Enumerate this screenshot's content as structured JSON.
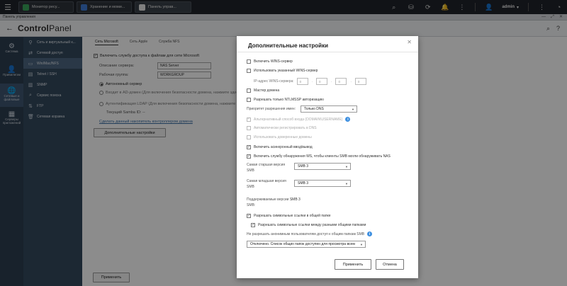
{
  "topbar": {
    "tabs": [
      {
        "label": "Монитор ресу...",
        "color": "#3aa55a"
      },
      {
        "label": "Хранение и моми...",
        "color": "#3f7bd6"
      },
      {
        "label": "Панель управ...",
        "color": "#e8e8e8"
      }
    ],
    "user": "admin"
  },
  "subbar": {
    "label": "Панель управления"
  },
  "header": {
    "title_prefix": "Control",
    "title_suffix": "Panel"
  },
  "rail": [
    {
      "label": "Система",
      "icon": "gear-icon",
      "glyph": "⚙"
    },
    {
      "label": "Привилегии",
      "icon": "user-icon",
      "glyph": "👤"
    },
    {
      "label": "Сетевые и файловые",
      "icon": "network-icon",
      "glyph": "🌐"
    },
    {
      "label": "Серверы приложений",
      "icon": "apps-icon",
      "glyph": "▦"
    }
  ],
  "subnav": [
    {
      "label": "Сеть и виртуальный к...",
      "glyph": "⚲"
    },
    {
      "label": "Сетевой доступ",
      "glyph": "⇄"
    },
    {
      "label": "Win/Mac/NFS",
      "glyph": "▭"
    },
    {
      "label": "Telnet / SSH",
      "glyph": "▤"
    },
    {
      "label": "SNMP",
      "glyph": "▥"
    },
    {
      "label": "Сервис поиска",
      "glyph": "⌕"
    },
    {
      "label": "FTP",
      "glyph": "⇅"
    },
    {
      "label": "Сетевая корзина",
      "glyph": "🗑"
    }
  ],
  "main": {
    "tabs": [
      "Сеть Microsoft",
      "Сеть Apple",
      "Служба NFS"
    ],
    "enable_label": "Включить службу доступа к файлам для сети Microsoft",
    "server_desc_label": "Описание сервера:",
    "server_desc_value": "NAS Server",
    "workgroup_label": "Рабочая группа:",
    "workgroup_value": "WORKGROUP",
    "standalone_label": "Автономный сервер",
    "ad_label": "Входит в AD-домен (Для включения безопасности домена, нажмите здесь.)",
    "ldap_label": "Аутентификация LDAP (Для включения безопасности домена, нажмите здесь.)",
    "samba_id_label": "Текущий Samba ID: --",
    "link_label": "Сделать данный накопитель контроллером домена",
    "advanced_button": "Дополнительные настройки",
    "apply_button": "Применить"
  },
  "modal": {
    "title": "Дополнительные настройки",
    "wins_server": "Включить WINS-сервер",
    "use_wins": "Использовать указанный WINS-сервер",
    "wins_ip_label": "IP-адрес WINS-сервера:",
    "ip_octets": [
      "0",
      "0",
      "0",
      "0"
    ],
    "domain_master": "Мастер домена",
    "ntlmssp": "Разрешать только NTLMSSP авторизацию",
    "name_resolution_label": "Приоритет разрешения имен:",
    "name_resolution_value": "Только DNS",
    "alt_login": "Альтернативный способ входа (DOMAIN\\USERNAME)",
    "auto_dns": "Автоматически регистрировать в DNS",
    "trusted_domains": "Использовать доверенные домены",
    "async_io": "Включить асинхронный ввод/вывод",
    "ws_discovery": "Включить службу обнаружения WS, чтобы клиенты SMB могли обнаруживать NAS",
    "highest_smb_label_1": "Самая старшая версия",
    "highest_smb_label_2": "SMB",
    "highest_smb_value": "SMB 3",
    "lowest_smb_label_1": "Самая младшая версия",
    "lowest_smb_label_2": "SMB",
    "lowest_smb_value": "SMB 3",
    "supported_label_1": "Поддерживаемые версии",
    "supported_label_2": "SMB:",
    "supported_value": "SMB 3",
    "symlinks": "Разрешать символьные ссылки в общей папке",
    "wide_links": "Разрешать символьные ссылки между разными общими папками",
    "anon_label": "Не разрешать анонимным пользователям доступ к общим папкам SMB",
    "anon_value": "Отключено. Список общих папок доступен для просмотра всем",
    "apply_button": "Применить",
    "cancel_button": "Отмена"
  }
}
